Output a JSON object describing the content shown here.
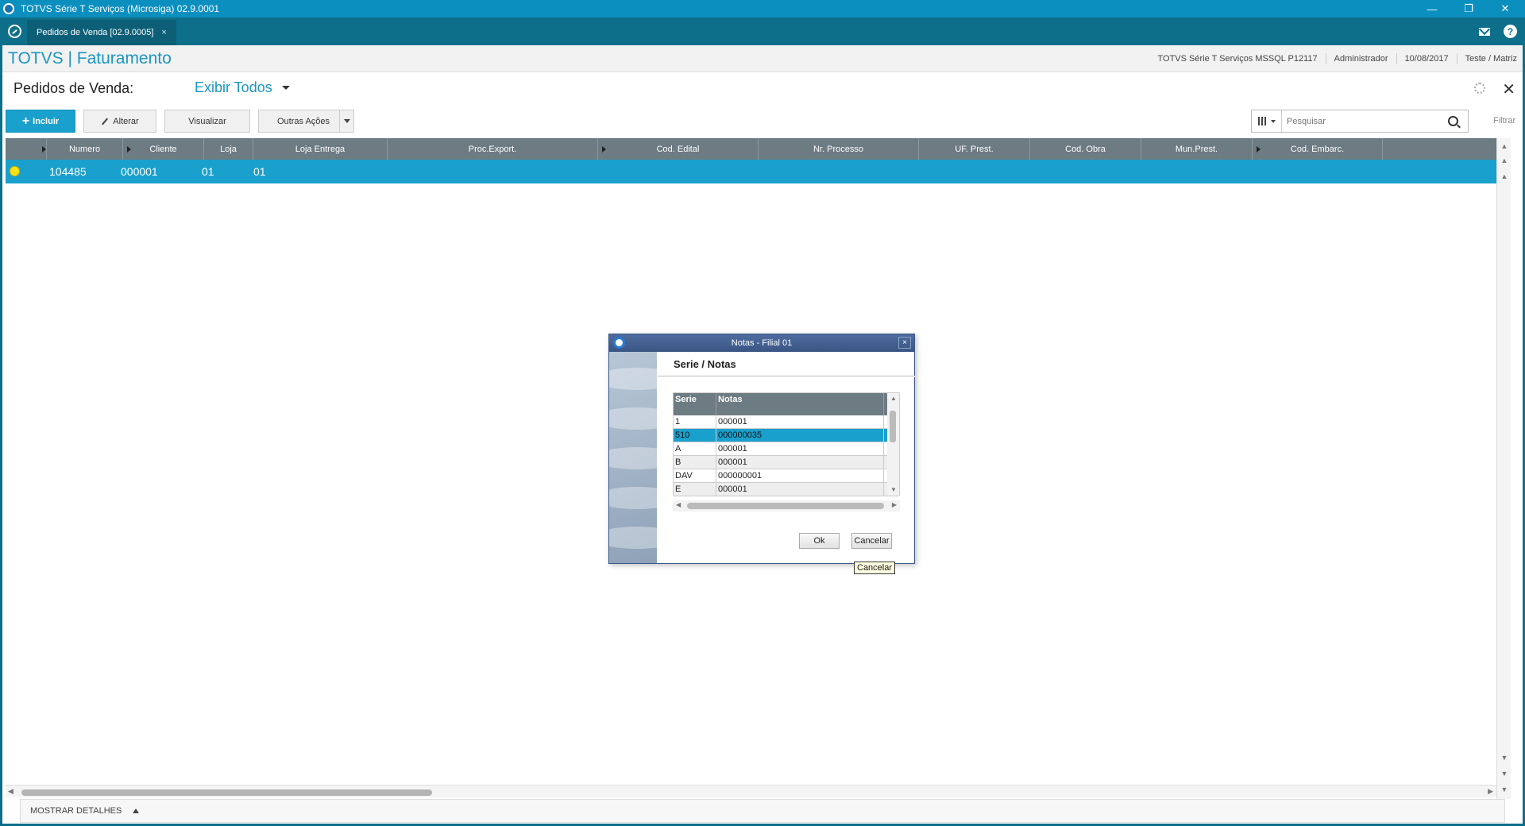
{
  "window": {
    "title": "TOTVS Série T Serviços (Microsiga) 02.9.0001",
    "minimize": "—",
    "restore": "❐",
    "close": "✕"
  },
  "tabs": [
    {
      "label": "Pedidos de Venda [02.9.0005]",
      "close": "×"
    }
  ],
  "header": {
    "brand": "TOTVS | Faturamento",
    "environment": "TOTVS Série T Serviços MSSQL P12117",
    "user": "Administrador",
    "date": "10/08/2017",
    "branch": "Teste / Matriz"
  },
  "page": {
    "title": "Pedidos de Venda:",
    "view": "Exibir Todos",
    "close": "✕"
  },
  "toolbar": {
    "include": "Incluir",
    "alter": "Alterar",
    "view": "Visualizar",
    "other_actions": "Outras Ações",
    "search_placeholder": "Pesquisar",
    "filter": "Filtrar"
  },
  "grid": {
    "columns": [
      "Numero",
      "Cliente",
      "Loja",
      "Loja Entrega",
      "Proc.Export.",
      "Cod. Edital",
      "Nr. Processo",
      "UF. Prest.",
      "Cod. Obra",
      "Mun.Prest.",
      "Cod. Embarc."
    ],
    "rows": [
      {
        "numero": "104485",
        "cliente": "000001",
        "loja": "01",
        "loja_entrega": "01"
      }
    ]
  },
  "footer": {
    "details": "MOSTRAR DETALHES"
  },
  "dialog": {
    "title": "Notas - Filial 01",
    "close": "×",
    "heading": "Serie / Notas",
    "columns": [
      "Serie",
      "Notas"
    ],
    "rows": [
      {
        "serie": "1",
        "nota": "000001"
      },
      {
        "serie": "510",
        "nota": "000000035"
      },
      {
        "serie": "A",
        "nota": "000001"
      },
      {
        "serie": "B",
        "nota": "000001"
      },
      {
        "serie": "DAV",
        "nota": "000000001"
      },
      {
        "serie": "E",
        "nota": "000001"
      }
    ],
    "ok": "Ok",
    "cancel": "Cancelar",
    "tooltip": "Cancelar"
  },
  "colors": {
    "titlebar": "#0b8fbf",
    "tabbar": "#0e6f8a",
    "accent": "#1aa0cc",
    "grid_header": "#6d7b83",
    "status": "#f5e21c"
  }
}
